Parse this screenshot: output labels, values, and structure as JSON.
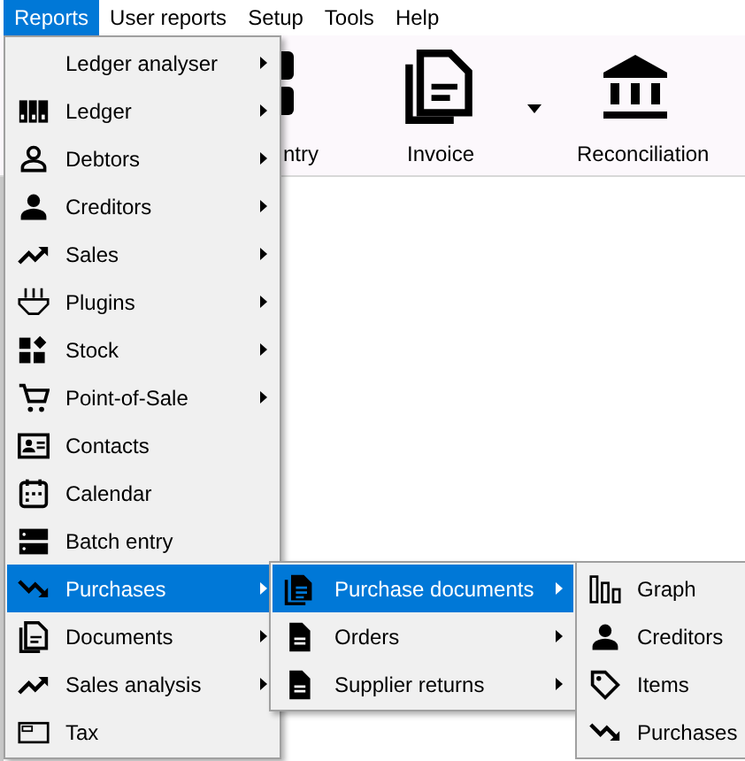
{
  "menubar": [
    {
      "label": "Reports",
      "selected": true
    },
    {
      "label": "User reports",
      "selected": false
    },
    {
      "label": "Setup",
      "selected": false
    },
    {
      "label": "Tools",
      "selected": false
    },
    {
      "label": "Help",
      "selected": false
    }
  ],
  "toolbar": [
    {
      "label": "ntry",
      "dropdown": false
    },
    {
      "label": "Invoice",
      "dropdown": true
    },
    {
      "label": "Reconciliation",
      "dropdown": false
    }
  ],
  "reports_menu": [
    {
      "label": "Ledger analyser",
      "submenu": true,
      "selected": false
    },
    {
      "label": "Ledger",
      "submenu": true,
      "selected": false
    },
    {
      "label": "Debtors",
      "submenu": true,
      "selected": false
    },
    {
      "label": "Creditors",
      "submenu": true,
      "selected": false
    },
    {
      "label": "Sales",
      "submenu": true,
      "selected": false
    },
    {
      "label": "Plugins",
      "submenu": true,
      "selected": false
    },
    {
      "label": "Stock",
      "submenu": true,
      "selected": false
    },
    {
      "label": "Point-of-Sale",
      "submenu": true,
      "selected": false
    },
    {
      "label": "Contacts",
      "submenu": false,
      "selected": false
    },
    {
      "label": "Calendar",
      "submenu": false,
      "selected": false
    },
    {
      "label": "Batch entry",
      "submenu": false,
      "selected": false
    },
    {
      "label": "Purchases",
      "submenu": true,
      "selected": true
    },
    {
      "label": "Documents",
      "submenu": true,
      "selected": false
    },
    {
      "label": "Sales analysis",
      "submenu": true,
      "selected": false
    },
    {
      "label": "Tax",
      "submenu": false,
      "selected": false
    }
  ],
  "purchases_menu": [
    {
      "label": "Purchase documents",
      "submenu": true,
      "selected": true
    },
    {
      "label": "Orders",
      "submenu": true,
      "selected": false
    },
    {
      "label": "Supplier returns",
      "submenu": true,
      "selected": false
    }
  ],
  "purchase_documents_menu": [
    {
      "label": "Graph",
      "submenu": false,
      "selected": false
    },
    {
      "label": "Creditors",
      "submenu": false,
      "selected": false
    },
    {
      "label": "Items",
      "submenu": false,
      "selected": false
    },
    {
      "label": "Purchases",
      "submenu": false,
      "selected": false
    }
  ]
}
